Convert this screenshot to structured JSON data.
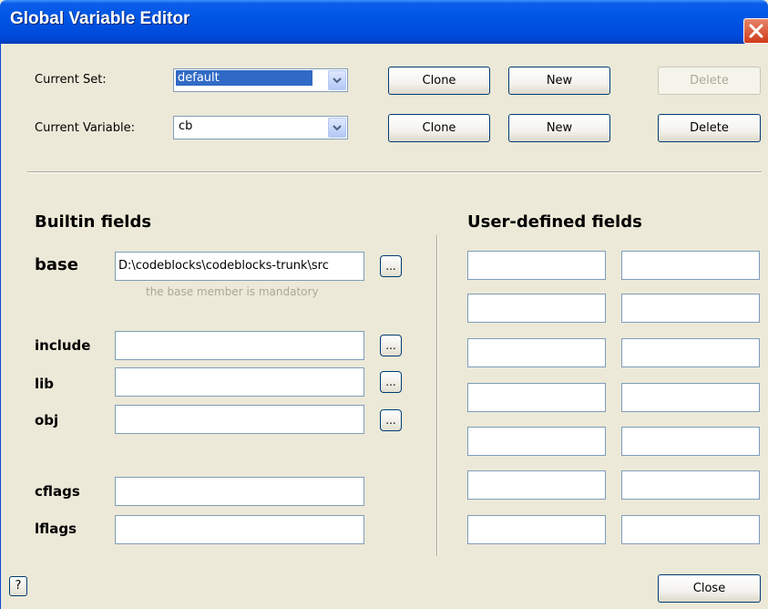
{
  "window": {
    "title": "Global Variable Editor"
  },
  "top": {
    "current_set_label": "Current Set:",
    "current_set_value": "default",
    "current_variable_label": "Current Variable:",
    "current_variable_value": "cb",
    "set_clone": "Clone",
    "set_new": "New",
    "set_delete": "Delete",
    "var_clone": "Clone",
    "var_new": "New",
    "var_delete": "Delete"
  },
  "builtin": {
    "heading": "Builtin fields",
    "base_label": "base",
    "base_value": "D:\\codeblocks\\codeblocks-trunk\\src",
    "base_note": "the base member is mandatory",
    "include_label": "include",
    "include_value": "",
    "lib_label": "lib",
    "lib_value": "",
    "obj_label": "obj",
    "obj_value": "",
    "cflags_label": "cflags",
    "cflags_value": "",
    "lflags_label": "lflags",
    "lflags_value": "",
    "browse_label": "..."
  },
  "user": {
    "heading": "User-defined fields",
    "rows": [
      {
        "name": "",
        "value": ""
      },
      {
        "name": "",
        "value": ""
      },
      {
        "name": "",
        "value": ""
      },
      {
        "name": "",
        "value": ""
      },
      {
        "name": "",
        "value": ""
      },
      {
        "name": "",
        "value": ""
      },
      {
        "name": "",
        "value": ""
      }
    ]
  },
  "footer": {
    "help_label": "?",
    "close_label": "Close"
  },
  "colors": {
    "titlebar": "#0055E5",
    "dialog_bg": "#ECE9D8",
    "selection": "#316AC5",
    "close_red": "#D03A1A"
  }
}
